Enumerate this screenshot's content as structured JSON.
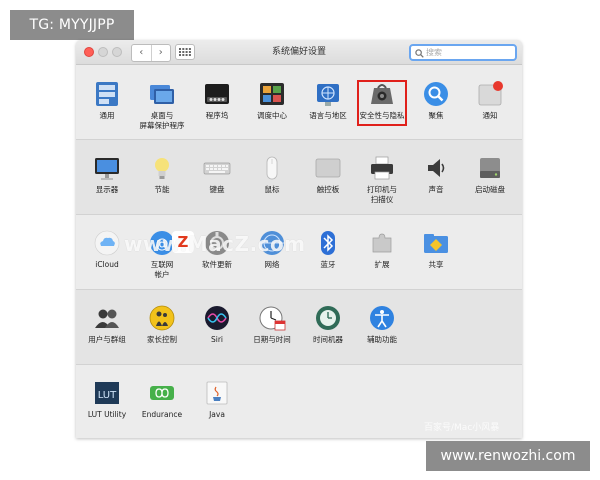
{
  "overlay": {
    "tg_label": "TG: MYYJJPP",
    "website_label": "www.renwozhi.com",
    "watermark": "www.MacZ.com",
    "watermark_badge": "Z",
    "credit": "百家号/Mac小风暴"
  },
  "window": {
    "title": "系统偏好设置",
    "nav": {
      "back": "‹",
      "forward": "›"
    },
    "search": {
      "value": "",
      "placeholder": "搜索"
    }
  },
  "rows": [
    {
      "items": [
        {
          "label": "通用",
          "icon": "general-icon"
        },
        {
          "label": "桌面与\n屏幕保护程序",
          "icon": "desktop-screensaver-icon"
        },
        {
          "label": "程序坞",
          "icon": "dock-icon"
        },
        {
          "label": "调度中心",
          "icon": "mission-control-icon"
        },
        {
          "label": "语言与地区",
          "icon": "language-region-icon"
        },
        {
          "label": "安全性与隐私",
          "icon": "security-privacy-icon"
        },
        {
          "label": "聚焦",
          "icon": "spotlight-icon"
        },
        {
          "label": "通知",
          "icon": "notifications-icon"
        }
      ]
    },
    {
      "items": [
        {
          "label": "显示器",
          "icon": "displays-icon"
        },
        {
          "label": "节能",
          "icon": "energy-saver-icon"
        },
        {
          "label": "键盘",
          "icon": "keyboard-icon"
        },
        {
          "label": "鼠标",
          "icon": "mouse-icon"
        },
        {
          "label": "触控板",
          "icon": "trackpad-icon"
        },
        {
          "label": "打印机与\n扫描仪",
          "icon": "printers-scanners-icon"
        },
        {
          "label": "声音",
          "icon": "sound-icon"
        },
        {
          "label": "启动磁盘",
          "icon": "startup-disk-icon"
        }
      ]
    },
    {
      "items": [
        {
          "label": "iCloud",
          "icon": "icloud-icon"
        },
        {
          "label": "互联网\n帐户",
          "icon": "internet-accounts-icon"
        },
        {
          "label": "软件更新",
          "icon": "software-update-icon"
        },
        {
          "label": "网络",
          "icon": "network-icon"
        },
        {
          "label": "蓝牙",
          "icon": "bluetooth-icon"
        },
        {
          "label": "扩展",
          "icon": "extensions-icon"
        },
        {
          "label": "共享",
          "icon": "sharing-icon"
        }
      ]
    },
    {
      "items": [
        {
          "label": "用户与群组",
          "icon": "users-groups-icon"
        },
        {
          "label": "家长控制",
          "icon": "parental-controls-icon"
        },
        {
          "label": "Siri",
          "icon": "siri-icon"
        },
        {
          "label": "日期与时间",
          "icon": "date-time-icon"
        },
        {
          "label": "时间机器",
          "icon": "time-machine-icon"
        },
        {
          "label": "辅助功能",
          "icon": "accessibility-icon"
        }
      ]
    },
    {
      "items": [
        {
          "label": "LUT Utility",
          "icon": "lut-utility-icon"
        },
        {
          "label": "Endurance",
          "icon": "endurance-icon"
        },
        {
          "label": "Java",
          "icon": "java-icon"
        }
      ]
    }
  ],
  "highlight_color": "#e0201b"
}
